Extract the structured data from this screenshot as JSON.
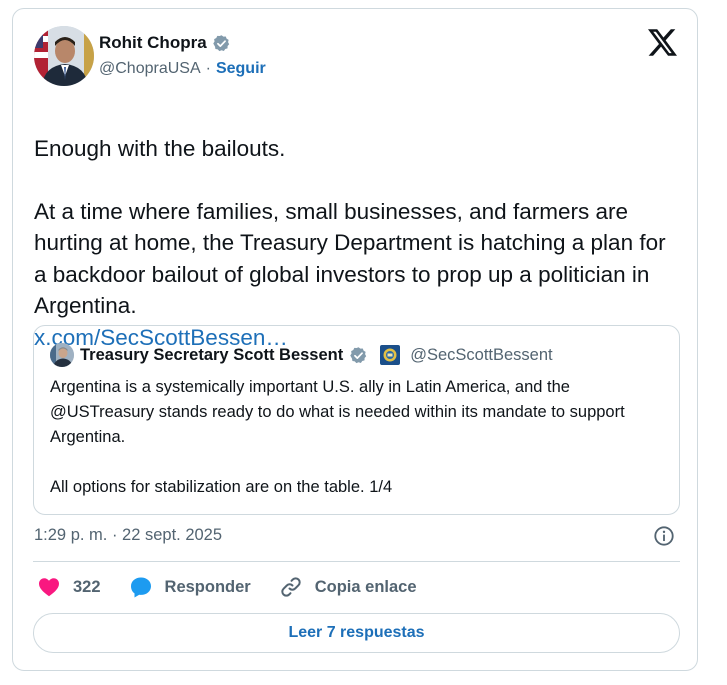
{
  "author": {
    "name": "Rohit Chopra",
    "handle": "@ChopraUSA",
    "separator": "·",
    "follow_label": "Seguir"
  },
  "tweet": {
    "text": "Enough with the bailouts.\n\nAt a time where families, small businesses, and farmers are hurting at home, the Treasury Department is hatching a plan for a backdoor bailout of global investors to prop up a politician in Argentina.",
    "link": "x.com/SecScottBessen…"
  },
  "quote": {
    "name": "Treasury Secretary Scott Bessent",
    "handle": "@SecScottBessent",
    "text": "Argentina is a systemically important U.S. ally in Latin America, and the @USTreasury stands ready to do what is needed within its mandate to support Argentina.\n\nAll options for stabilization are on the table. 1/4"
  },
  "meta": {
    "timestamp": "1:29 p. m. · 22 sept. 2025"
  },
  "actions": {
    "likes": "322",
    "reply_label": "Responder",
    "copy_label": "Copia enlace"
  },
  "read_replies_label": "Leer 7 respuestas",
  "icons": {
    "verified": "verified-badge-icon",
    "x_logo": "x-logo-icon",
    "info": "info-icon",
    "heart": "heart-icon",
    "reply": "reply-bubble-icon",
    "link": "link-icon",
    "gov_badge": "treasury-seal-icon"
  },
  "colors": {
    "accent": "#1d6fb8",
    "verified": "#829aab",
    "heart": "#f91880",
    "reply_bubble": "#1d9bf0",
    "muted": "#536471",
    "border": "#cfd9de"
  }
}
